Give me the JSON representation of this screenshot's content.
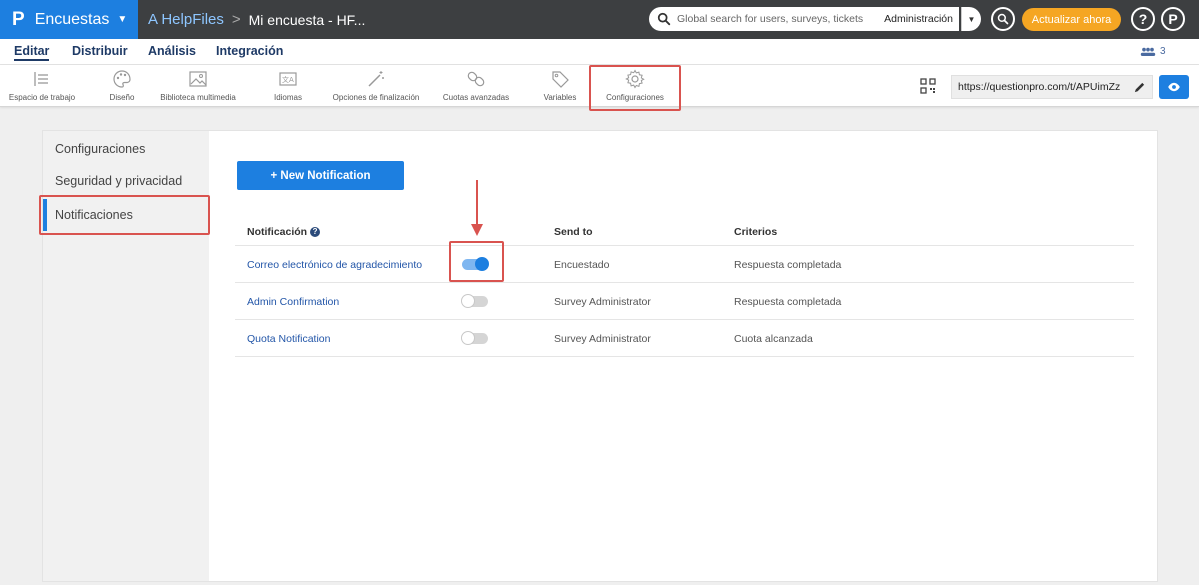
{
  "topbar": {
    "brand_logo": "P",
    "brand_label": "Encuestas",
    "breadcrumb_folder": "A HelpFiles",
    "breadcrumb_separator": ">",
    "breadcrumb_survey": "Mi encuesta - HF...",
    "search_placeholder": "Global search for users, surveys, tickets",
    "admin_label": "Administración",
    "upgrade_label": "Actualizar ahora",
    "help_label": "?",
    "profile_label": "P",
    "brand_color": "#1d7fe0",
    "upgrade_color": "#f5a623"
  },
  "menu": {
    "items": [
      "Editar",
      "Distribuir",
      "Análisis",
      "Integración"
    ],
    "users_count": "3"
  },
  "toolbar": {
    "items": [
      {
        "label": "Espacio de trabajo",
        "icon": "workspace-icon"
      },
      {
        "label": "Diseño",
        "icon": "palette-icon"
      },
      {
        "label": "Biblioteca multimedia",
        "icon": "image-icon"
      },
      {
        "label": "Idiomas",
        "icon": "translate-icon"
      },
      {
        "label": "Opciones de finalización",
        "icon": "magic-wand-icon"
      },
      {
        "label": "Cuotas avanzadas",
        "icon": "chain-icon"
      },
      {
        "label": "Variables",
        "icon": "tag-icon"
      },
      {
        "label": "Configuraciones",
        "icon": "gear-icon"
      }
    ],
    "survey_url": "https://questionpro.com/t/APUimZz"
  },
  "sidenav": {
    "items": [
      "Configuraciones",
      "Seguridad y privacidad",
      "Notificaciones"
    ],
    "active": "Notificaciones"
  },
  "main": {
    "new_button_label": "+   New Notification",
    "columns": [
      "Notificación",
      "Send to",
      "Criterios"
    ],
    "rows": [
      {
        "name": "Correo electrónico de agradecimiento",
        "enabled": true,
        "send_to": "Encuestado",
        "criteria": "Respuesta completada"
      },
      {
        "name": "Admin Confirmation",
        "enabled": false,
        "send_to": "Survey Administrator",
        "criteria": "Respuesta completada"
      },
      {
        "name": "Quota Notification",
        "enabled": false,
        "send_to": "Survey Administrator",
        "criteria": "Cuota alcanzada"
      }
    ]
  }
}
